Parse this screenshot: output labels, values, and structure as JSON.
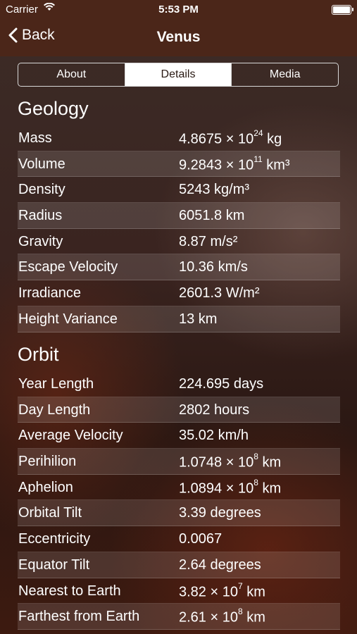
{
  "status_bar": {
    "carrier": "Carrier",
    "time": "5:53 PM"
  },
  "nav": {
    "back_label": "Back",
    "title": "Venus"
  },
  "tabs": [
    {
      "label": "About",
      "selected": false
    },
    {
      "label": "Details",
      "selected": true
    },
    {
      "label": "Media",
      "selected": false
    }
  ],
  "geology": {
    "title": "Geology",
    "rows": [
      {
        "label": "Mass",
        "value": "4.8675 × 10",
        "exp": "24",
        "unit": " kg"
      },
      {
        "label": "Volume",
        "value": "9.2843 × 10",
        "exp": "11",
        "unit": " km³"
      },
      {
        "label": "Density",
        "value": "5243 kg/m³",
        "exp": "",
        "unit": ""
      },
      {
        "label": "Radius",
        "value": "6051.8 km",
        "exp": "",
        "unit": ""
      },
      {
        "label": "Gravity",
        "value": "8.87 m/s²",
        "exp": "",
        "unit": ""
      },
      {
        "label": "Escape Velocity",
        "value": "10.36 km/s",
        "exp": "",
        "unit": ""
      },
      {
        "label": "Irradiance",
        "value": "2601.3 W/m²",
        "exp": "",
        "unit": ""
      },
      {
        "label": "Height Variance",
        "value": "13 km",
        "exp": "",
        "unit": ""
      }
    ]
  },
  "orbit": {
    "title": "Orbit",
    "rows": [
      {
        "label": "Year Length",
        "value": "224.695 days",
        "exp": "",
        "unit": ""
      },
      {
        "label": "Day Length",
        "value": "2802 hours",
        "exp": "",
        "unit": ""
      },
      {
        "label": "Average Velocity",
        "value": "35.02 km/h",
        "exp": "",
        "unit": ""
      },
      {
        "label": "Perihilion",
        "value": "1.0748 × 10",
        "exp": "8",
        "unit": " km"
      },
      {
        "label": "Aphelion",
        "value": "1.0894 × 10",
        "exp": "8",
        "unit": " km"
      },
      {
        "label": "Orbital Tilt",
        "value": "3.39 degrees",
        "exp": "",
        "unit": ""
      },
      {
        "label": "Eccentricity",
        "value": "0.0067",
        "exp": "",
        "unit": ""
      },
      {
        "label": "Equator Tilt",
        "value": "2.64 degrees",
        "exp": "",
        "unit": ""
      },
      {
        "label": "Nearest to Earth",
        "value": "3.82 × 10",
        "exp": "7",
        "unit": " km"
      },
      {
        "label": "Farthest from Earth",
        "value": "2.61 × 10",
        "exp": "8",
        "unit": " km"
      }
    ]
  }
}
